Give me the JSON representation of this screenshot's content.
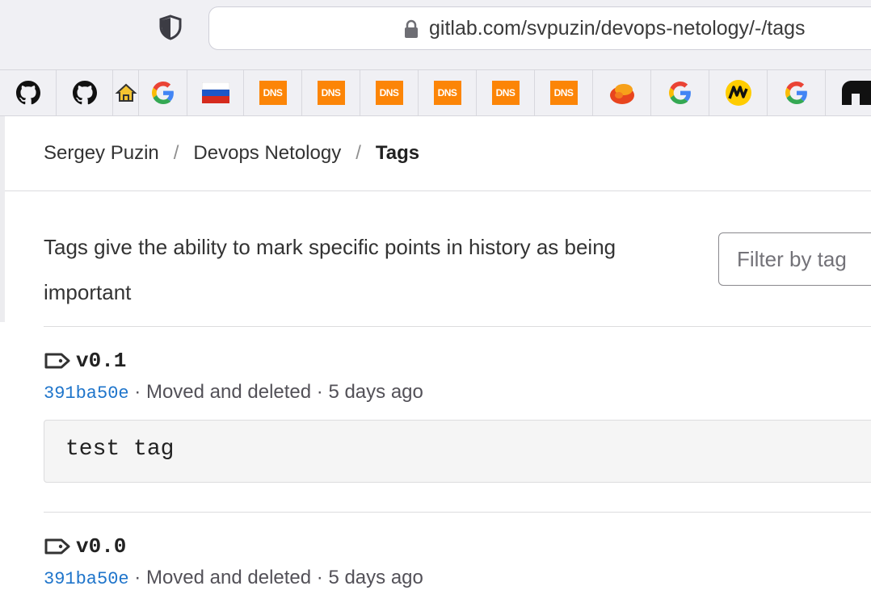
{
  "browser": {
    "url": "gitlab.com/svpuzin/devops-netology/-/tags",
    "bookmarks": [
      {
        "icon": "github-icon"
      },
      {
        "icon": "github-icon"
      },
      {
        "icon": "home-icon"
      },
      {
        "icon": "google-icon"
      },
      {
        "icon": "russia-flag-icon"
      },
      {
        "icon": "dns-icon",
        "label": "DNS"
      },
      {
        "icon": "dns-icon",
        "label": "DNS"
      },
      {
        "icon": "dns-icon",
        "label": "DNS"
      },
      {
        "icon": "dns-icon",
        "label": "DNS"
      },
      {
        "icon": "dns-icon",
        "label": "DNS"
      },
      {
        "icon": "dns-icon",
        "label": "DNS"
      },
      {
        "icon": "pochta-bank-icon"
      },
      {
        "icon": "google-icon"
      },
      {
        "icon": "yandex-market-icon"
      },
      {
        "icon": "google-icon"
      },
      {
        "icon": "app-icon"
      }
    ]
  },
  "breadcrumb": {
    "items": [
      "Sergey Puzin",
      "Devops Netology"
    ],
    "current": "Tags",
    "separator": "/"
  },
  "description": "Tags give the ability to mark specific points in history as being important",
  "filter": {
    "placeholder": "Filter by tag"
  },
  "tags": [
    {
      "name": "v0.1",
      "sha": "391ba50e",
      "commit_message": "Moved and deleted",
      "time": "5 days ago",
      "message": "test tag"
    },
    {
      "name": "v0.0",
      "sha": "391ba50e",
      "commit_message": "Moved and deleted",
      "time": "5 days ago"
    }
  ],
  "meta_separator": " · ",
  "colors": {
    "link": "#1f75cb",
    "dns": "#fc8507"
  }
}
